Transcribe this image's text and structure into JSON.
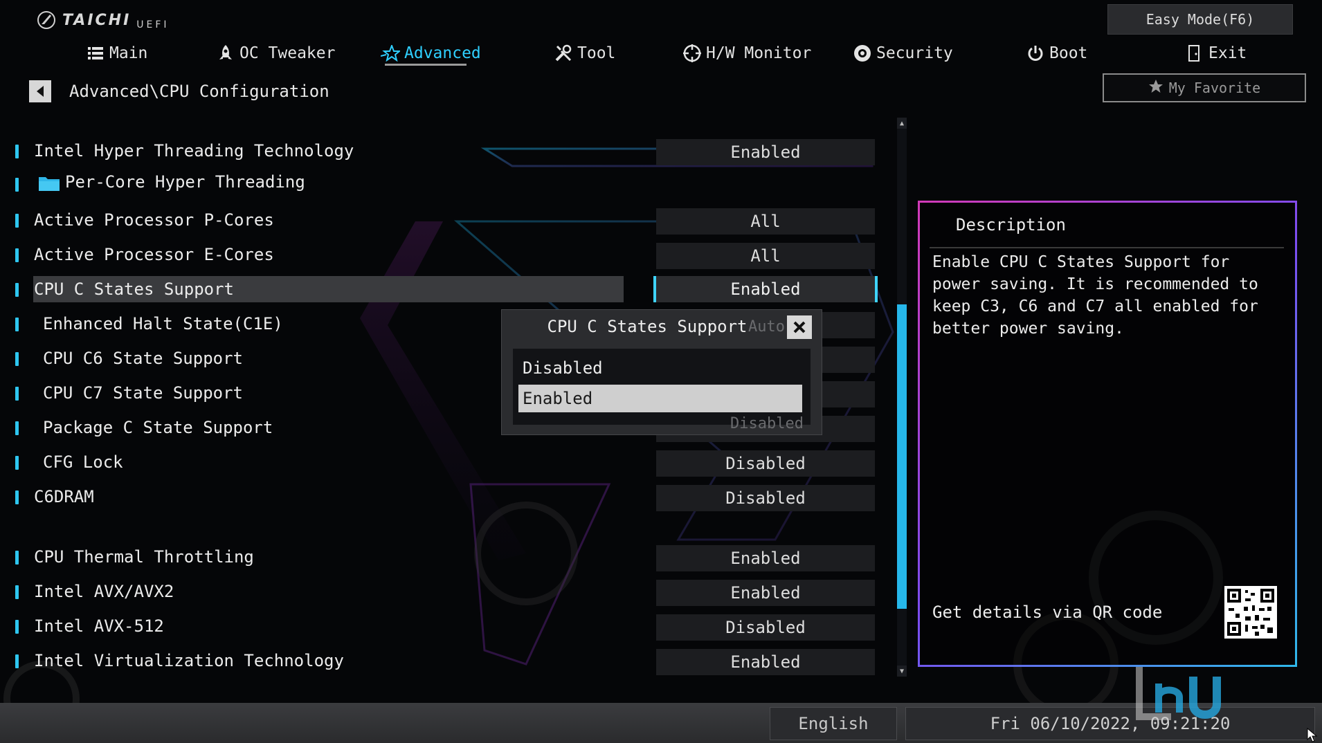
{
  "header": {
    "brand": "TAICHI",
    "brand_sub": "UEFI",
    "easy_mode": "Easy Mode(F6)",
    "favorite": "My Favorite",
    "tabs": [
      {
        "label": "Main",
        "icon": "list-icon"
      },
      {
        "label": "OC Tweaker",
        "icon": "rocket-icon"
      },
      {
        "label": "Advanced",
        "icon": "star-icon",
        "active": true
      },
      {
        "label": "Tool",
        "icon": "tools-icon"
      },
      {
        "label": "H/W Monitor",
        "icon": "crosshair-icon"
      },
      {
        "label": "Security",
        "icon": "shield-icon"
      },
      {
        "label": "Boot",
        "icon": "power-icon"
      },
      {
        "label": "Exit",
        "icon": "exit-door-icon"
      }
    ]
  },
  "breadcrumb": "Advanced\\CPU Configuration",
  "settings": [
    {
      "label": "Intel Hyper Threading Technology",
      "value": "Enabled"
    },
    {
      "label": "Per-Core Hyper Threading",
      "value": "",
      "folder": true
    },
    {
      "label": "Active Processor P-Cores",
      "value": "All"
    },
    {
      "label": "Active Processor E-Cores",
      "value": "All"
    },
    {
      "label": "CPU C States Support",
      "value": "Enabled",
      "selected": true
    },
    {
      "label": "Enhanced Halt State(C1E)",
      "value": "Auto",
      "indent": true
    },
    {
      "label": "CPU C6 State Support",
      "value": "",
      "indent": true
    },
    {
      "label": "CPU C7 State Support",
      "value": "",
      "indent": true
    },
    {
      "label": "Package C State Support",
      "value": "Disabled",
      "indent": true
    },
    {
      "label": "CFG Lock",
      "value": "Disabled",
      "indent": true
    },
    {
      "label": "C6DRAM",
      "value": "Disabled"
    },
    {
      "label": "CPU Thermal Throttling",
      "value": "Enabled"
    },
    {
      "label": "Intel AVX/AVX2",
      "value": "Enabled"
    },
    {
      "label": "Intel AVX-512",
      "value": "Disabled"
    },
    {
      "label": "Intel Virtualization Technology",
      "value": "Enabled"
    }
  ],
  "popup": {
    "title": "CPU C States Support",
    "options": [
      "Disabled",
      "Enabled"
    ],
    "selected": "Enabled"
  },
  "description": {
    "title": "Description",
    "body": "Enable CPU C States Support for power saving. It is recommended to keep C3, C6 and C7 all enabled for better power saving.",
    "qr_label": "Get details via QR code"
  },
  "footer": {
    "language": "English",
    "datetime": "Fri 06/10/2022, 09:21:20"
  },
  "colors": {
    "accent": "#2fd0ff",
    "selection": "#3a3b3e"
  }
}
